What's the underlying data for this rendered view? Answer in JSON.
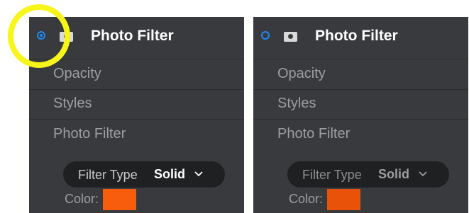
{
  "panels": [
    {
      "title": "Photo Filter",
      "radio_selected": true,
      "rows": [
        "Opacity",
        "Styles",
        "Photo Filter"
      ],
      "filter_type_label": "Filter Type",
      "filter_type_value": "Solid",
      "color_label": "Color:",
      "color_value": "#f75d0d"
    },
    {
      "title": "Photo Filter",
      "radio_selected": false,
      "rows": [
        "Opacity",
        "Styles",
        "Photo Filter"
      ],
      "filter_type_label": "Filter Type",
      "filter_type_value": "Solid",
      "color_label": "Color:",
      "color_value": "#e85309"
    }
  ],
  "annotation": {
    "highlight_color": "#f8f51a"
  },
  "icons": {
    "radio": "radio-button-icon",
    "layer": "camera-icon",
    "dropdown": "chevron-down-icon"
  }
}
